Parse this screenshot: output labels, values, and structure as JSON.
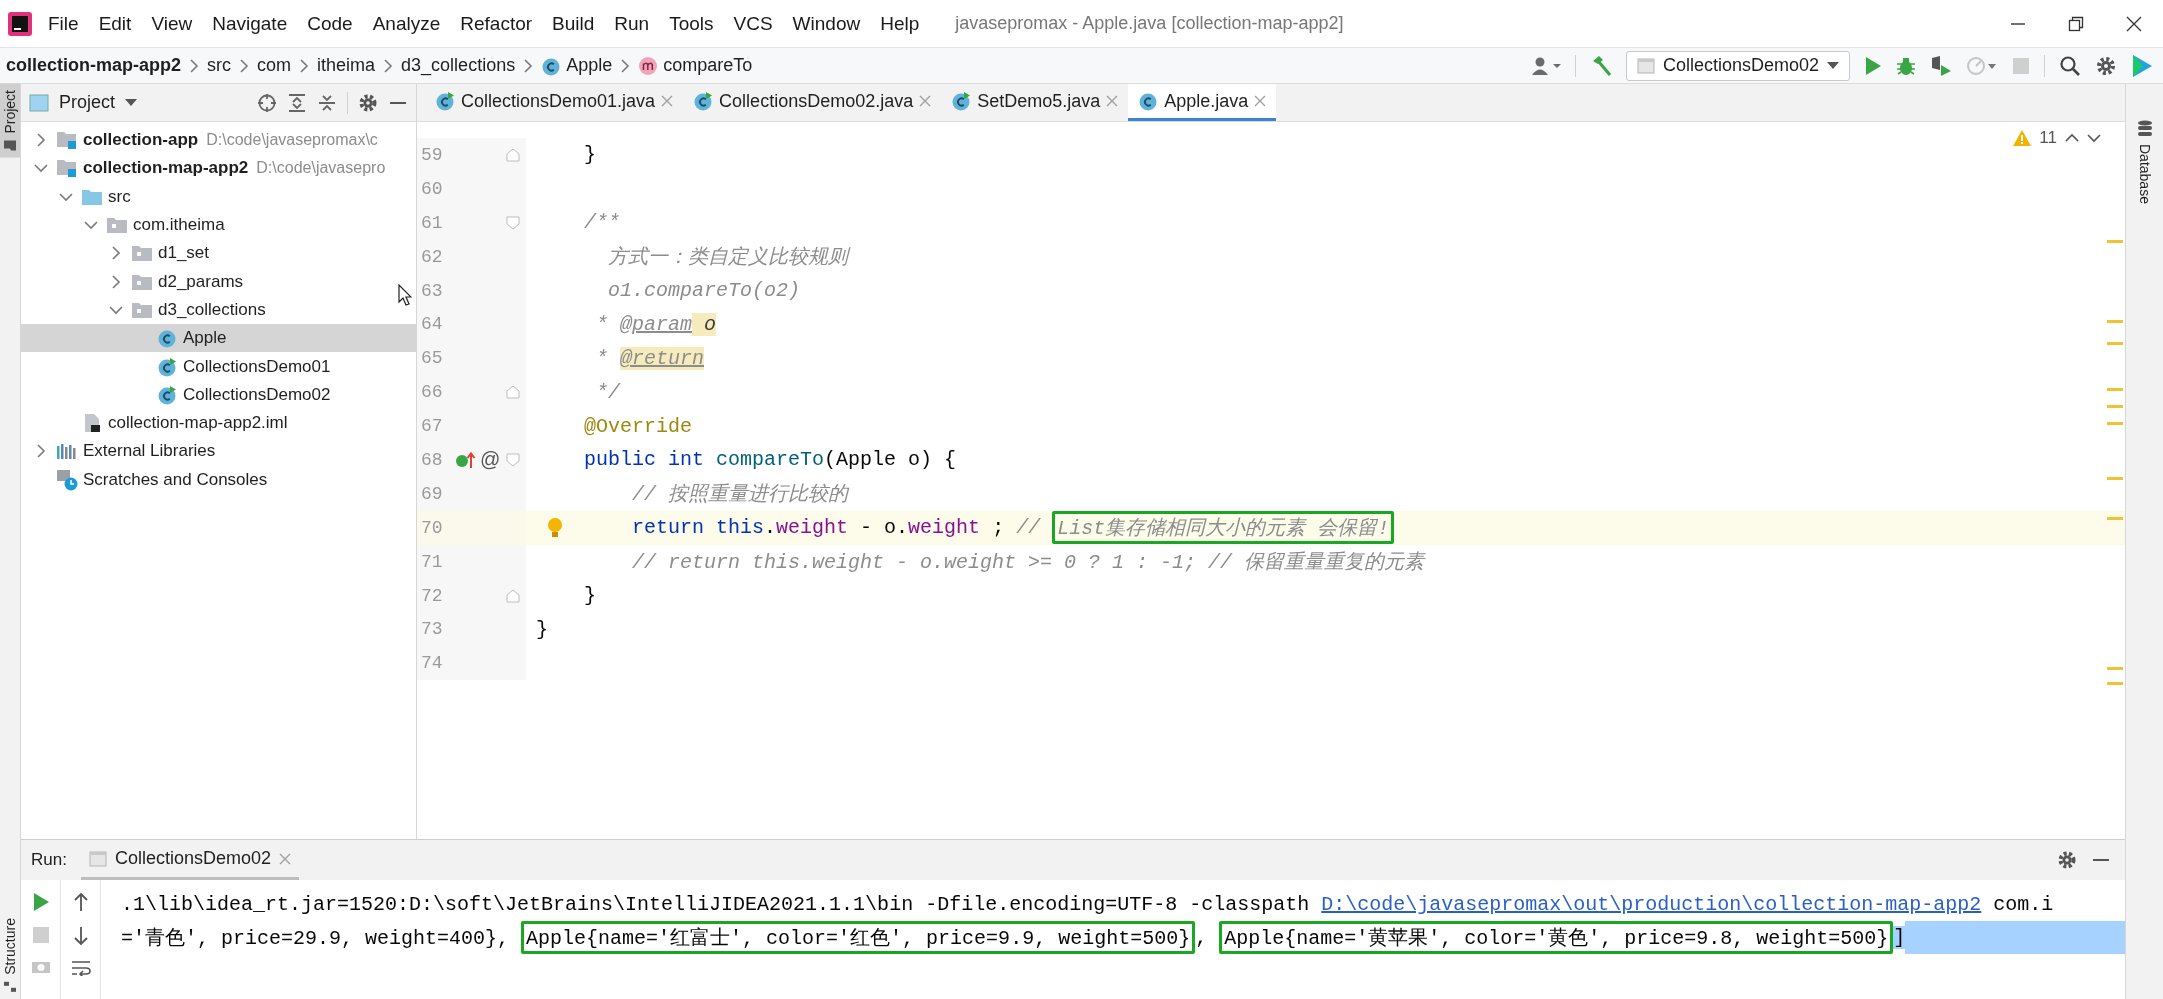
{
  "menu": [
    "File",
    "Edit",
    "View",
    "Navigate",
    "Code",
    "Analyze",
    "Refactor",
    "Build",
    "Run",
    "Tools",
    "VCS",
    "Window",
    "Help"
  ],
  "window": {
    "title": "javasepromax - Apple.java [collection-map-app2]"
  },
  "breadcrumbs": [
    {
      "label": "collection-map-app2",
      "kind": "project"
    },
    {
      "label": "src",
      "kind": "folder"
    },
    {
      "label": "com",
      "kind": "folder"
    },
    {
      "label": "itheima",
      "kind": "folder"
    },
    {
      "label": "d3_collections",
      "kind": "folder"
    },
    {
      "label": "Apple",
      "kind": "class"
    },
    {
      "label": "compareTo",
      "kind": "method"
    }
  ],
  "toolbar": {
    "run_config": "CollectionsDemo02"
  },
  "left_stripe": [
    {
      "label": "Project",
      "selected": true
    }
  ],
  "bottom_stripe": [
    {
      "label": "Structure",
      "selected": false
    }
  ],
  "right_stripe": [
    {
      "label": "Database",
      "selected": false
    }
  ],
  "project": {
    "title": "Project",
    "tree": [
      {
        "label": "collection-app",
        "path": "D:\\code\\javasepromax\\c",
        "kind": "module",
        "expanded": false,
        "selected": false
      },
      {
        "label": "collection-map-app2",
        "path": "D:\\code\\javasepro",
        "kind": "module",
        "expanded": true,
        "selected": false,
        "children": [
          {
            "label": "src",
            "kind": "source",
            "expanded": true,
            "selected": false,
            "children": [
              {
                "label": "com.itheima",
                "kind": "package",
                "expanded": true,
                "selected": false,
                "children": [
                  {
                    "label": "d1_set",
                    "kind": "package",
                    "expanded": false,
                    "selected": false
                  },
                  {
                    "label": "d2_params",
                    "kind": "package",
                    "expanded": false,
                    "selected": false
                  },
                  {
                    "label": "d3_collections",
                    "kind": "package",
                    "expanded": true,
                    "selected": false,
                    "children": [
                      {
                        "label": "Apple",
                        "kind": "class",
                        "selected": true
                      },
                      {
                        "label": "CollectionsDemo01",
                        "kind": "runnable",
                        "selected": false
                      },
                      {
                        "label": "CollectionsDemo02",
                        "kind": "runnable",
                        "selected": false
                      }
                    ]
                  }
                ]
              }
            ]
          },
          {
            "label": "collection-map-app2.iml",
            "kind": "file",
            "selected": false
          }
        ]
      },
      {
        "label": "External Libraries",
        "kind": "libraries",
        "expanded": false,
        "selected": false
      },
      {
        "label": "Scratches and Consoles",
        "kind": "scratches",
        "selected": false
      }
    ]
  },
  "tabs": [
    {
      "label": "CollectionsDemo01.java",
      "kind": "runnable",
      "selected": false
    },
    {
      "label": "CollectionsDemo02.java",
      "kind": "runnable",
      "selected": false
    },
    {
      "label": "SetDemo5.java",
      "kind": "runnable",
      "selected": false
    },
    {
      "label": "Apple.java",
      "kind": "class",
      "selected": true
    }
  ],
  "editor": {
    "warnings": "11",
    "lines": [
      {
        "number": "59",
        "current": false,
        "fold": {
          "kind": "end"
        },
        "tokens": [
          {
            "kind": "plain",
            "text": "    }"
          }
        ]
      },
      {
        "number": "60",
        "current": false
      },
      {
        "number": "61",
        "current": false,
        "fold": {
          "kind": "start"
        },
        "tokens": [
          {
            "kind": "doc",
            "text": "    /**"
          }
        ]
      },
      {
        "number": "62",
        "current": false,
        "tokens": [
          {
            "kind": "doc",
            "text": "      方式一：类自定义比较规则"
          }
        ]
      },
      {
        "number": "63",
        "current": false,
        "tokens": [
          {
            "kind": "doc",
            "text": "      o1.compareTo(o2)"
          }
        ]
      },
      {
        "number": "64",
        "current": false,
        "tokens": [
          {
            "kind": "doc",
            "text": "     * "
          },
          {
            "kind": "doctag",
            "text": "@param"
          },
          {
            "kind": "docparam",
            "text": " o"
          }
        ]
      },
      {
        "number": "65",
        "current": false,
        "tokens": [
          {
            "kind": "doc",
            "text": "     * "
          },
          {
            "kind": "doctagmark",
            "text": "@return"
          }
        ]
      },
      {
        "number": "66",
        "current": false,
        "fold": {
          "kind": "end"
        },
        "tokens": [
          {
            "kind": "doc",
            "text": "     */"
          }
        ]
      },
      {
        "number": "67",
        "current": false,
        "tokens": [
          {
            "kind": "annotation",
            "text": "    @Override"
          }
        ]
      },
      {
        "number": "68",
        "current": false,
        "fold": {
          "kind": "start"
        },
        "gutter": {
          "kind": "implements",
          "mark": "@"
        },
        "tokens": [
          {
            "kind": "keyword",
            "text": "    public int "
          },
          {
            "kind": "method",
            "text": "compareTo"
          },
          {
            "kind": "plain",
            "text": "(Apple o) {"
          }
        ]
      },
      {
        "number": "69",
        "current": false,
        "tokens": [
          {
            "kind": "comment",
            "text": "        // 按照重量进行比较的"
          }
        ]
      },
      {
        "number": "70",
        "current": true,
        "bulb": true,
        "tokens": [
          {
            "kind": "keyword",
            "text": "        return this"
          },
          {
            "kind": "plain",
            "text": "."
          },
          {
            "kind": "field",
            "text": "weight"
          },
          {
            "kind": "plain",
            "text": " - o."
          },
          {
            "kind": "field",
            "text": "weight"
          },
          {
            "kind": "plain",
            "text": " ; "
          },
          {
            "kind": "comment",
            "text": "// "
          },
          {
            "kind": "comment",
            "text": "List集存储相同大小的元素 会保留!",
            "framed": true
          }
        ]
      },
      {
        "number": "71",
        "current": false,
        "tokens": [
          {
            "kind": "comment",
            "text": "        // return this.weight - o.weight >= 0 ? 1 : -1; // 保留重量重复的元素"
          }
        ]
      },
      {
        "number": "72",
        "current": false,
        "fold": {
          "kind": "end"
        },
        "tokens": [
          {
            "kind": "plain",
            "text": "    }"
          }
        ]
      },
      {
        "number": "73",
        "current": false,
        "tokens": [
          {
            "kind": "plain",
            "text": "}"
          }
        ]
      },
      {
        "number": "74",
        "current": false
      }
    ]
  },
  "run": {
    "label": "Run:",
    "tab": "CollectionsDemo02",
    "lines": [
      {
        "segments": [
          {
            "kind": "plain",
            "text": ".1\\lib\\idea_rt.jar=1520:D:\\soft\\JetBrains\\IntelliJIDEA2021.1.1\\bin -Dfile.encoding=UTF-8 -classpath ",
            "framed": false,
            "selected": false
          },
          {
            "kind": "link",
            "text": "D:\\code\\javasepromax\\out\\production\\collection-map-app2",
            "framed": false,
            "selected": false
          },
          {
            "kind": "plain",
            "text": " com.i",
            "framed": false,
            "selected": false
          }
        ]
      },
      {
        "segments": [
          {
            "kind": "plain",
            "text": "='青色', price=29.9, weight=400}, ",
            "framed": false,
            "selected": false
          },
          {
            "kind": "plain",
            "text": "Apple{name='红富士', color='红色', price=9.9, weight=500}",
            "framed": true,
            "selected": false
          },
          {
            "kind": "plain",
            "text": ", ",
            "framed": false,
            "selected": false
          },
          {
            "kind": "plain",
            "text": "Apple{name='黄苹果', color='黄色', price=9.8, weight=500}",
            "framed": true,
            "selected": false
          },
          {
            "kind": "plain",
            "text": "]",
            "framed": false,
            "selected": true
          }
        ]
      }
    ]
  }
}
